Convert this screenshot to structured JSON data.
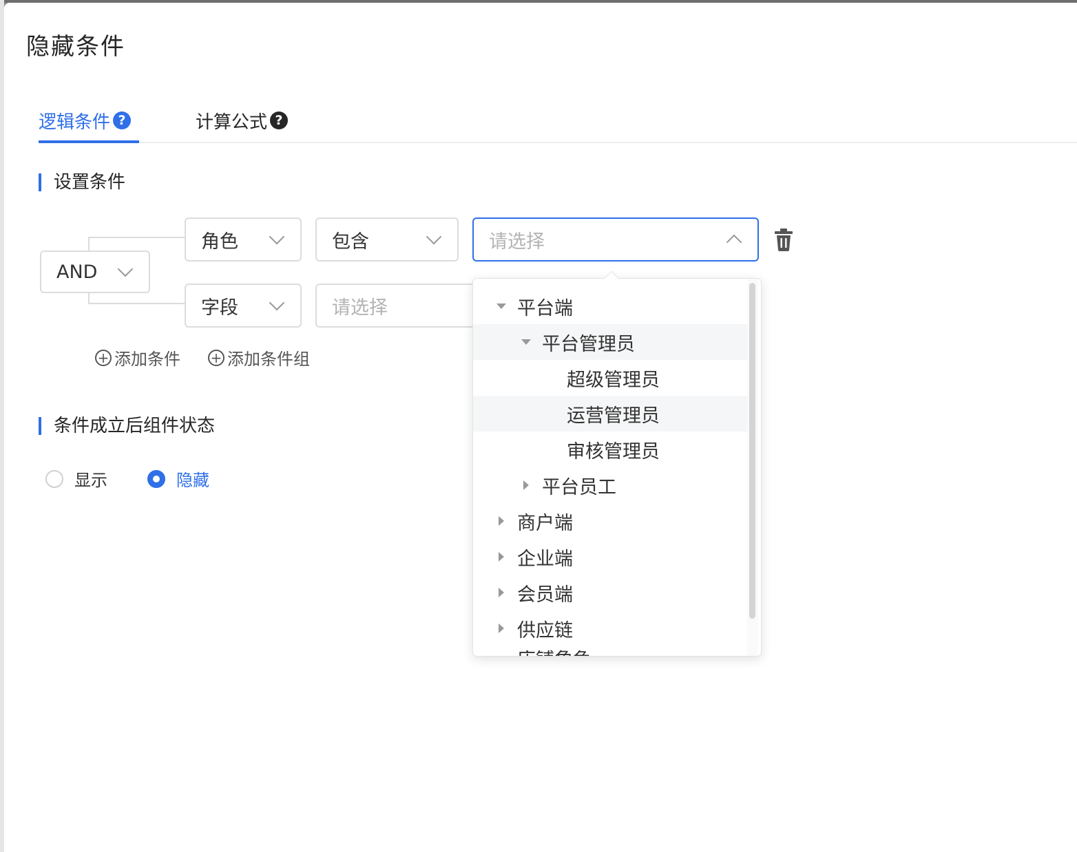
{
  "modal": {
    "title": "隐藏条件"
  },
  "tabs": [
    {
      "label": "逻辑条件",
      "help": "?"
    },
    {
      "label": "计算公式",
      "help": "?"
    }
  ],
  "sections": {
    "set_conditions": "设置条件",
    "state_after": "条件成立后组件状态"
  },
  "conditions": {
    "logic_operator": "AND",
    "rows": [
      {
        "field": "角色",
        "operator": "包含",
        "value_placeholder": "请选择"
      },
      {
        "field": "字段",
        "operator_placeholder": "请选择"
      }
    ]
  },
  "actions": {
    "add_condition": "添加条件",
    "add_condition_group": "添加条件组",
    "plus_glyph": "+"
  },
  "radio": {
    "options": [
      "显示",
      "隐藏"
    ],
    "selected": "隐藏"
  },
  "tree": {
    "nodes": [
      {
        "label": "平台端",
        "level": 0,
        "expander": "expanded"
      },
      {
        "label": "平台管理员",
        "level": 1,
        "expander": "expanded",
        "highlighted": true
      },
      {
        "label": "超级管理员",
        "level": 2,
        "expander": "none"
      },
      {
        "label": "运营管理员",
        "level": 2,
        "expander": "none",
        "highlighted": true
      },
      {
        "label": "审核管理员",
        "level": 2,
        "expander": "none"
      },
      {
        "label": "平台员工",
        "level": 1,
        "expander": "collapsed"
      },
      {
        "label": "商户端",
        "level": 0,
        "expander": "collapsed"
      },
      {
        "label": "企业端",
        "level": 0,
        "expander": "collapsed"
      },
      {
        "label": "会员端",
        "level": 0,
        "expander": "collapsed"
      },
      {
        "label": "供应链",
        "level": 0,
        "expander": "collapsed"
      }
    ],
    "cut_off_label": "店铺角色"
  },
  "colors": {
    "primary": "#2f6fe8",
    "text": "#262626",
    "placeholder": "#b3b3b3",
    "border": "#dcdcdc",
    "hover": "#f5f6f7"
  }
}
